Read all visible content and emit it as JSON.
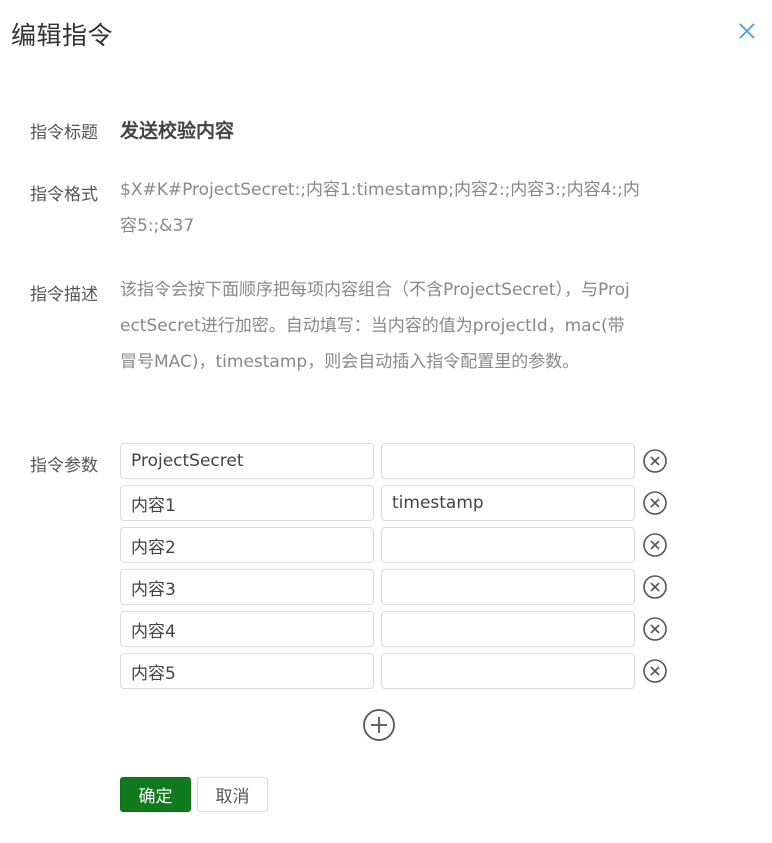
{
  "dialog": {
    "title": "编辑指令"
  },
  "fields": {
    "title_label": "指令标题",
    "title_value": "发送校验内容",
    "format_label": "指令格式",
    "format_value": "$X#K#ProjectSecret:;内容1:timestamp;内容2:;内容3:;内容4:;内容5:;&37",
    "desc_label": "指令描述",
    "desc_value": "该指令会按下面顺序把每项内容组合（不含ProjectSecret），与ProjectSecret进行加密。自动填写：当内容的值为projectId，mac(带冒号MAC)，timestamp，则会自动插入指令配置里的参数。",
    "params_label": "指令参数"
  },
  "params": [
    {
      "key": "ProjectSecret",
      "value": ""
    },
    {
      "key": "内容1",
      "value": "timestamp"
    },
    {
      "key": "内容2",
      "value": ""
    },
    {
      "key": "内容3",
      "value": ""
    },
    {
      "key": "内容4",
      "value": ""
    },
    {
      "key": "内容5",
      "value": ""
    }
  ],
  "buttons": {
    "confirm": "确定",
    "cancel": "取消"
  },
  "colors": {
    "primary": "#117a1c",
    "close_icon": "#4a9fd8"
  },
  "icons": {
    "close": "close-icon",
    "remove": "remove-circle-icon",
    "add": "add-circle-icon"
  }
}
